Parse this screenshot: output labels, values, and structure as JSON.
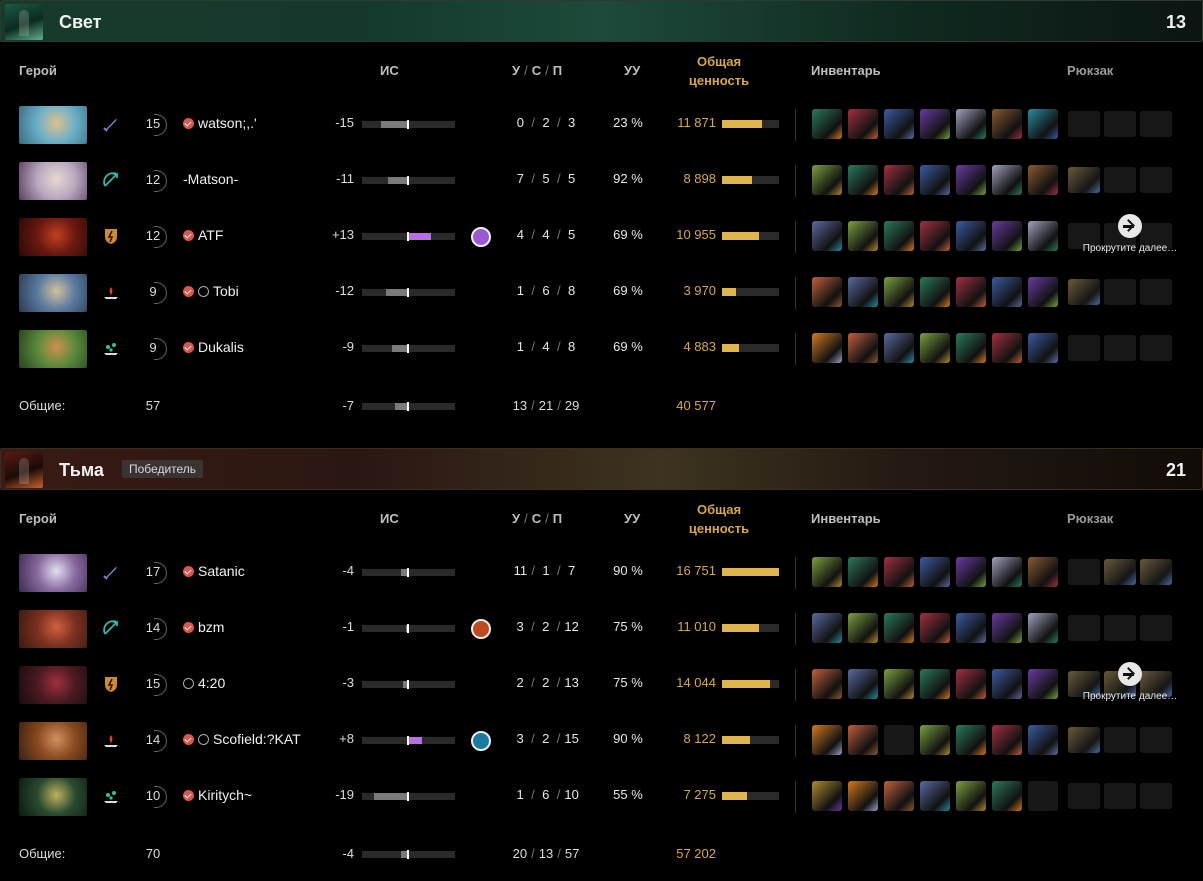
{
  "headers": {
    "hero": "Герой",
    "is": "ИС",
    "k": "У",
    "d": "С",
    "a": "П",
    "uu": "УУ",
    "networth_line1": "Общая",
    "networth_line2": "ценность",
    "inventory": "Инвентарь",
    "backpack": "Рюкзак"
  },
  "scroll_hint": "Прокрутите далее…",
  "totals_label": "Общие:",
  "teams": [
    {
      "name": "Свет",
      "score": "13",
      "winner_label": "",
      "totals": {
        "level": "57",
        "is": "-7",
        "k": "13",
        "d": "21",
        "a": "29",
        "networth": "40 577"
      },
      "players": [
        {
          "hero": "Medusa",
          "role": "carry",
          "level": "15",
          "name": "watson;,.'",
          "verified": true,
          "smurf": false,
          "is": "-15",
          "is_value": -15,
          "k": "0",
          "d": "2",
          "a": "3",
          "uu": "23 %",
          "networth": "11 871",
          "networth_value": 11871,
          "badge": ""
        },
        {
          "hero": "Invoker",
          "role": "mid",
          "level": "12",
          "name": "-Matson-",
          "verified": false,
          "smurf": false,
          "is": "-11",
          "is_value": -11,
          "k": "7",
          "d": "5",
          "a": "5",
          "uu": "92 %",
          "networth": "8 898",
          "networth_value": 8898,
          "badge": ""
        },
        {
          "hero": "Doom",
          "role": "offlane",
          "level": "12",
          "name": "ATF",
          "verified": true,
          "smurf": false,
          "is": "+13",
          "is_value": 13,
          "k": "4",
          "d": "4",
          "a": "5",
          "uu": "69 %",
          "networth": "10 955",
          "networth_value": 10955,
          "badge": "purple"
        },
        {
          "hero": "Tusk",
          "role": "soft-support",
          "level": "9",
          "name": "Tobi",
          "verified": true,
          "smurf": true,
          "is": "-12",
          "is_value": -12,
          "k": "1",
          "d": "6",
          "a": "8",
          "uu": "69 %",
          "networth": "3 970",
          "networth_value": 3970,
          "badge": ""
        },
        {
          "hero": "Windranger",
          "role": "hard-support",
          "level": "9",
          "name": "Dukalis",
          "verified": true,
          "smurf": false,
          "is": "-9",
          "is_value": -9,
          "k": "1",
          "d": "4",
          "a": "8",
          "uu": "69 %",
          "networth": "4 883",
          "networth_value": 4883,
          "badge": ""
        }
      ]
    },
    {
      "name": "Тьма",
      "score": "21",
      "winner_label": "Победитель",
      "totals": {
        "level": "70",
        "is": "-4",
        "k": "20",
        "d": "13",
        "a": "57",
        "networth": "57 202"
      },
      "players": [
        {
          "hero": "Templar Assassin",
          "role": "carry",
          "level": "17",
          "name": "Satanic",
          "verified": true,
          "smurf": false,
          "is": "-4",
          "is_value": -4,
          "k": "11",
          "d": "1",
          "a": "7",
          "uu": "90 %",
          "networth": "16 751",
          "networth_value": 16751,
          "badge": ""
        },
        {
          "hero": "Batrider",
          "role": "mid",
          "level": "14",
          "name": "bzm",
          "verified": true,
          "smurf": false,
          "is": "-1",
          "is_value": -1,
          "k": "3",
          "d": "2",
          "a": "12",
          "uu": "75 %",
          "networth": "11 010",
          "networth_value": 11010,
          "badge": "orange"
        },
        {
          "hero": "Bloodseeker",
          "role": "offlane",
          "level": "15",
          "name": "4:20",
          "verified": false,
          "smurf": true,
          "is": "-3",
          "is_value": -3,
          "k": "2",
          "d": "2",
          "a": "13",
          "uu": "75 %",
          "networth": "14 044",
          "networth_value": 14044,
          "badge": ""
        },
        {
          "hero": "Earthshaker",
          "role": "soft-support",
          "level": "14",
          "name": "Scofield:?KAT",
          "verified": true,
          "smurf": true,
          "is": "+8",
          "is_value": 8,
          "k": "3",
          "d": "2",
          "a": "15",
          "uu": "90 %",
          "networth": "8 122",
          "networth_value": 8122,
          "badge": "blue"
        },
        {
          "hero": "Nyx Assassin",
          "role": "hard-support",
          "level": "10",
          "name": "Kiritych~",
          "verified": true,
          "smurf": false,
          "is": "-19",
          "is_value": -19,
          "k": "1",
          "d": "6",
          "a": "10",
          "uu": "55 %",
          "networth": "7 275",
          "networth_value": 7275,
          "badge": ""
        }
      ]
    }
  ],
  "colors": {
    "accent_gold": "#d9a64a",
    "is_positive": "#b86ee6",
    "is_negative": "#7a7a7a"
  }
}
